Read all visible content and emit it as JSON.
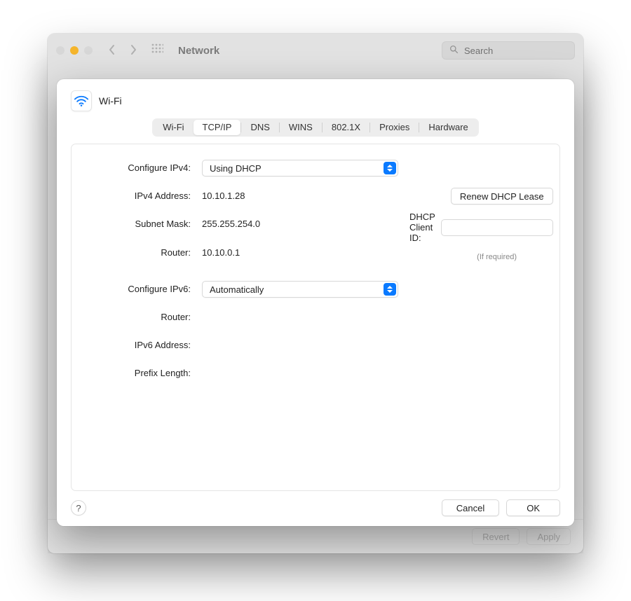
{
  "toolbar": {
    "title": "Network",
    "search_placeholder": "Search"
  },
  "footer": {
    "revert": "Revert",
    "apply": "Apply"
  },
  "sheet": {
    "interface": "Wi-Fi",
    "tabs": [
      "Wi-Fi",
      "TCP/IP",
      "DNS",
      "WINS",
      "802.1X",
      "Proxies",
      "Hardware"
    ],
    "active_tab": "TCP/IP",
    "labels": {
      "configure_ipv4": "Configure IPv4:",
      "ipv4_address": "IPv4 Address:",
      "subnet_mask": "Subnet Mask:",
      "router4": "Router:",
      "configure_ipv6": "Configure IPv6:",
      "router6": "Router:",
      "ipv6_address": "IPv6 Address:",
      "prefix_length": "Prefix Length:",
      "dhcp_client_id": "DHCP Client ID:",
      "if_required": "(If required)"
    },
    "values": {
      "configure_ipv4": "Using DHCP",
      "ipv4_address": "10.10.1.28",
      "subnet_mask": "255.255.254.0",
      "router4": "10.10.0.1",
      "configure_ipv6": "Automatically",
      "router6": "",
      "ipv6_address": "",
      "prefix_length": "",
      "dhcp_client_id": ""
    },
    "buttons": {
      "renew": "Renew DHCP Lease",
      "help": "?",
      "cancel": "Cancel",
      "ok": "OK"
    }
  }
}
